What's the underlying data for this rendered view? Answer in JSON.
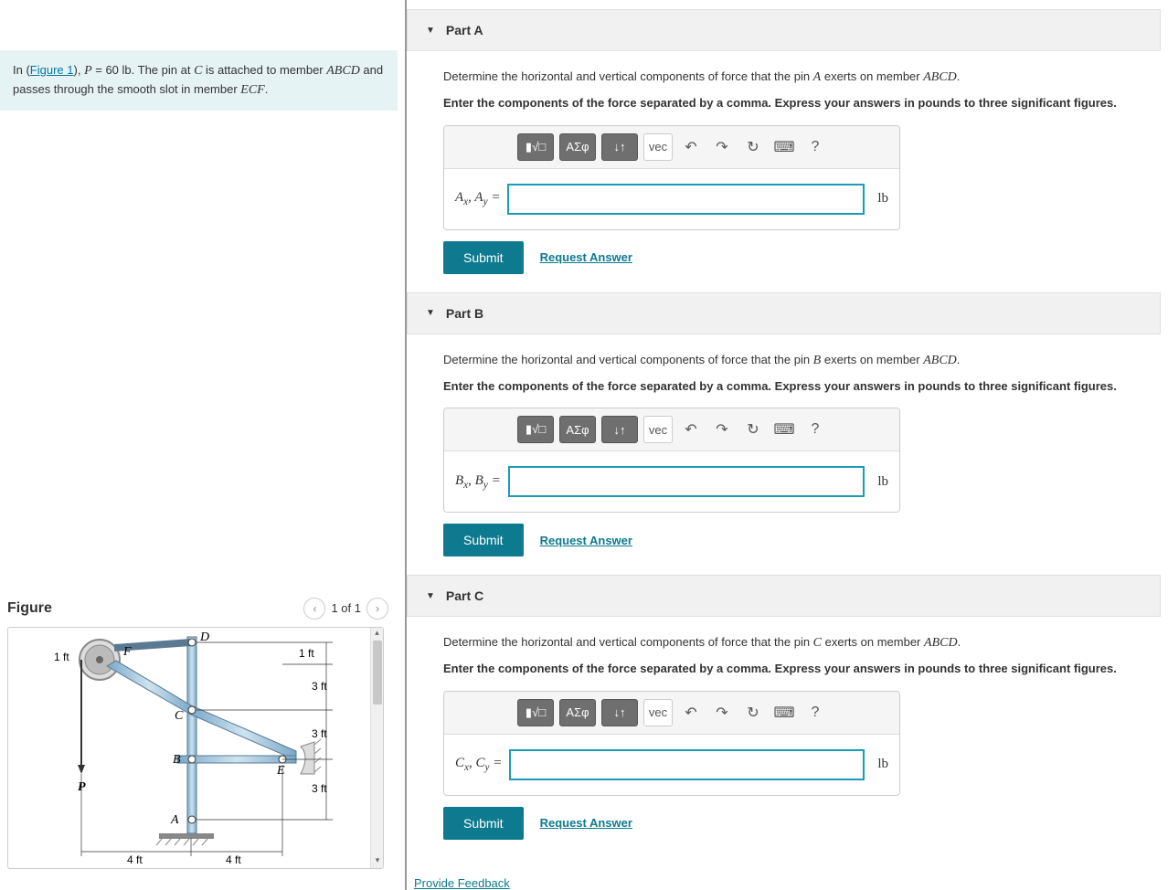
{
  "problem": {
    "intro_pre": "In (",
    "figure_link": "Figure 1",
    "intro_mid": "), ",
    "P_var": "P",
    "P_eq": " = 60 ",
    "P_unit": "lb",
    "intro_post1": ". The pin at ",
    "C_var": "C",
    "intro_post2": " is attached to member ",
    "ABCD": "ABCD",
    "intro_post3": " and passes through the smooth slot in member ",
    "ECF": "ECF",
    "period": "."
  },
  "figure": {
    "heading": "Figure",
    "counter": "1 of 1",
    "labels": {
      "D": "D",
      "F": "F",
      "C": "C",
      "B": "B",
      "E": "E",
      "A": "A",
      "P": "P",
      "d1ft": "1 ft",
      "d1ft_right": "1 ft",
      "d3ft1": "3 ft",
      "d3ft2": "3 ft",
      "d3ft3": "3 ft",
      "d4ft1": "4 ft",
      "d4ft2": "4 ft"
    }
  },
  "toolbar": {
    "templates": "▮√□",
    "greek": "ΑΣφ",
    "arrows": "↓↑",
    "vec": "vec",
    "undo": "↶",
    "redo": "↷",
    "reset": "↻",
    "keyboard": "⌨",
    "help": "?"
  },
  "parts": [
    {
      "id": "A",
      "title": "Part A",
      "desc_pre": "Determine the horizontal and vertical components of force that the pin ",
      "pin": "A",
      "desc_mid": " exerts on member ",
      "member": "ABCD",
      "desc_post": ".",
      "instr": "Enter the components of the force separated by a comma. Express your answers in pounds to three significant figures.",
      "var_a": "A",
      "sub_a": "x",
      "var_b": "A",
      "sub_b": "y",
      "unit": "lb",
      "submit": "Submit",
      "request": "Request Answer"
    },
    {
      "id": "B",
      "title": "Part B",
      "desc_pre": "Determine the horizontal and vertical components of force that the pin ",
      "pin": "B",
      "desc_mid": " exerts on member ",
      "member": "ABCD",
      "desc_post": ".",
      "instr": "Enter the components of the force separated by a comma. Express your answers in pounds to three significant figures.",
      "var_a": "B",
      "sub_a": "x",
      "var_b": "B",
      "sub_b": "y",
      "unit": "lb",
      "submit": "Submit",
      "request": "Request Answer"
    },
    {
      "id": "C",
      "title": "Part C",
      "desc_pre": "Determine the horizontal and vertical components of force that the pin ",
      "pin": "C",
      "desc_mid": " exerts on member ",
      "member": "ABCD",
      "desc_post": ".",
      "instr": "Enter the components of the force separated by a comma. Express your answers in pounds to three significant figures.",
      "var_a": "C",
      "sub_a": "x",
      "var_b": "C",
      "sub_b": "y",
      "unit": "lb",
      "submit": "Submit",
      "request": "Request Answer"
    }
  ],
  "feedback": "Provide Feedback"
}
